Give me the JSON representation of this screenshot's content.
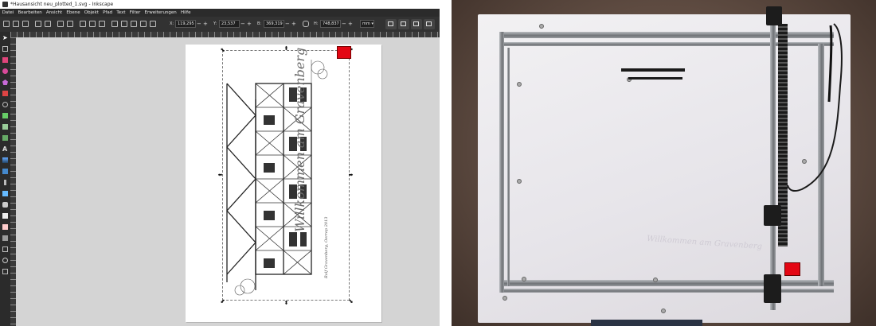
{
  "inkscape": {
    "window_title": "*Hausansicht neu_plotted_1.svg - Inkscape",
    "menu": [
      "Datei",
      "Bearbeiten",
      "Ansicht",
      "Ebene",
      "Objekt",
      "Pfad",
      "Text",
      "Filter",
      "Erweiterungen",
      "Hilfe"
    ],
    "toolbar": {
      "x_label": "X:",
      "x_value": "119,295",
      "y_label": "Y:",
      "y_value": "23,537",
      "w_label": "B:",
      "w_value": "369,319",
      "h_label": "H:",
      "h_value": "748,837",
      "plus": "+",
      "minus": "−",
      "unit": "mm"
    },
    "artwork": {
      "welcome_text": "Willkommen am Gravenberg",
      "signature_text": "Rolf Gravenberg, Oerrep 2013"
    },
    "marker_color": "#e30613"
  },
  "photo": {
    "marker_color": "#e30613",
    "faint_text": "Willkommen am Gravenberg"
  }
}
